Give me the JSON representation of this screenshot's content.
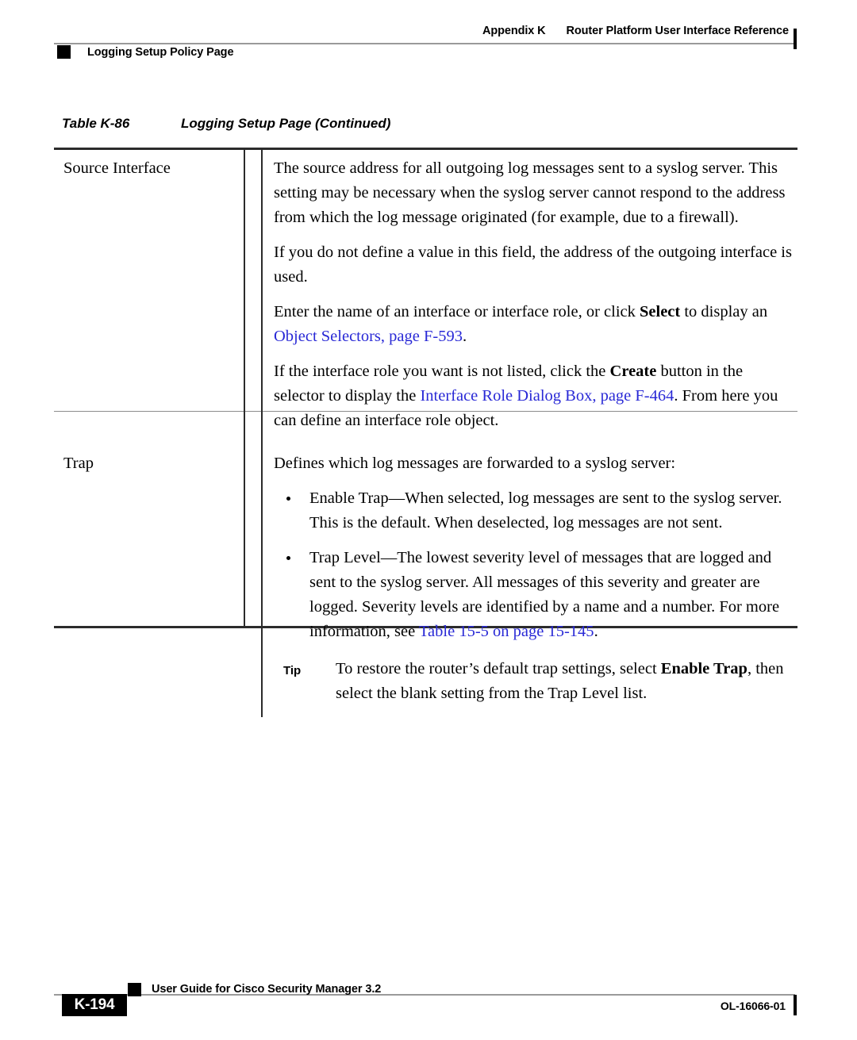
{
  "header": {
    "appendix": "Appendix K",
    "title": "Router Platform User Interface Reference",
    "section": "Logging Setup Policy Page"
  },
  "caption": {
    "number": "Table K-86",
    "title": "Logging Setup Page (Continued)"
  },
  "table": {
    "rows": [
      {
        "label": "Source Interface",
        "paragraphs": [
          {
            "runs": [
              {
                "text": "The source address for all outgoing log messages sent to a syslog server. This setting may be necessary when the syslog server cannot respond to the address from which the log message originated (for example, due to a firewall).",
                "style": "plain"
              }
            ]
          },
          {
            "runs": [
              {
                "text": "If you do not define a value in this field, the address of the outgoing interface is used.",
                "style": "plain"
              }
            ]
          },
          {
            "runs": [
              {
                "text": "Enter the name of an interface or interface role, or click ",
                "style": "plain"
              },
              {
                "text": "Select",
                "style": "bold"
              },
              {
                "text": " to display an ",
                "style": "plain"
              },
              {
                "text": "Object Selectors, page F-593",
                "style": "link"
              },
              {
                "text": ".",
                "style": "plain"
              }
            ]
          },
          {
            "runs": [
              {
                "text": "If the interface role you want is not listed, click the ",
                "style": "plain"
              },
              {
                "text": "Create",
                "style": "bold"
              },
              {
                "text": " button in the selector to display the ",
                "style": "plain"
              },
              {
                "text": "Interface Role Dialog Box, page F-464",
                "style": "link"
              },
              {
                "text": ". From here you can define an interface role object.",
                "style": "plain"
              }
            ]
          }
        ],
        "bullets": [],
        "tip": null
      },
      {
        "label": "Trap",
        "paragraphs": [
          {
            "runs": [
              {
                "text": "Defines which log messages are forwarded to a syslog server:",
                "style": "plain"
              }
            ]
          }
        ],
        "bullets": [
          {
            "runs": [
              {
                "text": "Enable Trap—When selected, log messages are sent to the syslog server. This is the default. When deselected, log messages are not sent.",
                "style": "plain"
              }
            ]
          },
          {
            "runs": [
              {
                "text": "Trap Level—The lowest severity level of messages that are logged and sent to the syslog server. All messages of this severity and greater are logged. Severity levels are identified by a name and a number. For more information, see ",
                "style": "plain"
              },
              {
                "text": "Table 15-5 on page 15-145",
                "style": "link"
              },
              {
                "text": ".",
                "style": "plain"
              }
            ]
          }
        ],
        "tip": {
          "label": "Tip",
          "runs": [
            {
              "text": "To restore the router’s default trap settings, select ",
              "style": "plain"
            },
            {
              "text": "Enable Trap",
              "style": "bold"
            },
            {
              "text": ", then select the blank setting from the Trap Level list.",
              "style": "plain"
            }
          ]
        }
      }
    ]
  },
  "footer": {
    "guide": "User Guide for Cisco Security Manager 3.2",
    "page_number": "K-194",
    "doc_number": "OL-16066-01"
  },
  "colors": {
    "link": "#2929d6",
    "rule_light": "#9a9a9a",
    "rule_dark": "#2b2b2b",
    "text": "#000000"
  }
}
